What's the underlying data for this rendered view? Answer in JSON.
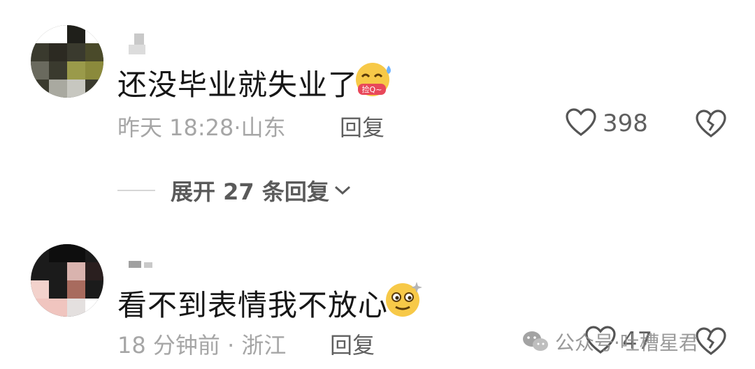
{
  "comments": [
    {
      "text": "还没毕业就失业了",
      "emoji_label": "捡Q~",
      "emoji_name": "grin-sweat-emoji",
      "time": "昨天 18:28",
      "location": "山东",
      "reply_label": "回复",
      "likes": "398",
      "expand_label": "展开 27 条回复"
    },
    {
      "text": "看不到表情我不放心",
      "emoji_name": "dizzy-emoji",
      "time": "18 分钟前",
      "location": "浙江",
      "reply_label": "回复",
      "likes": "47"
    }
  ],
  "separator": "·",
  "watermark": {
    "text": "公众号·吐槽星君",
    "icon": "wechat-icon"
  },
  "colors": {
    "text": "#161616",
    "meta": "#a6a6a6",
    "action": "#5f5f5f",
    "emoji": "#f7c948"
  },
  "icons": [
    "heart-outline-icon",
    "broken-heart-icon",
    "chevron-down-icon"
  ]
}
